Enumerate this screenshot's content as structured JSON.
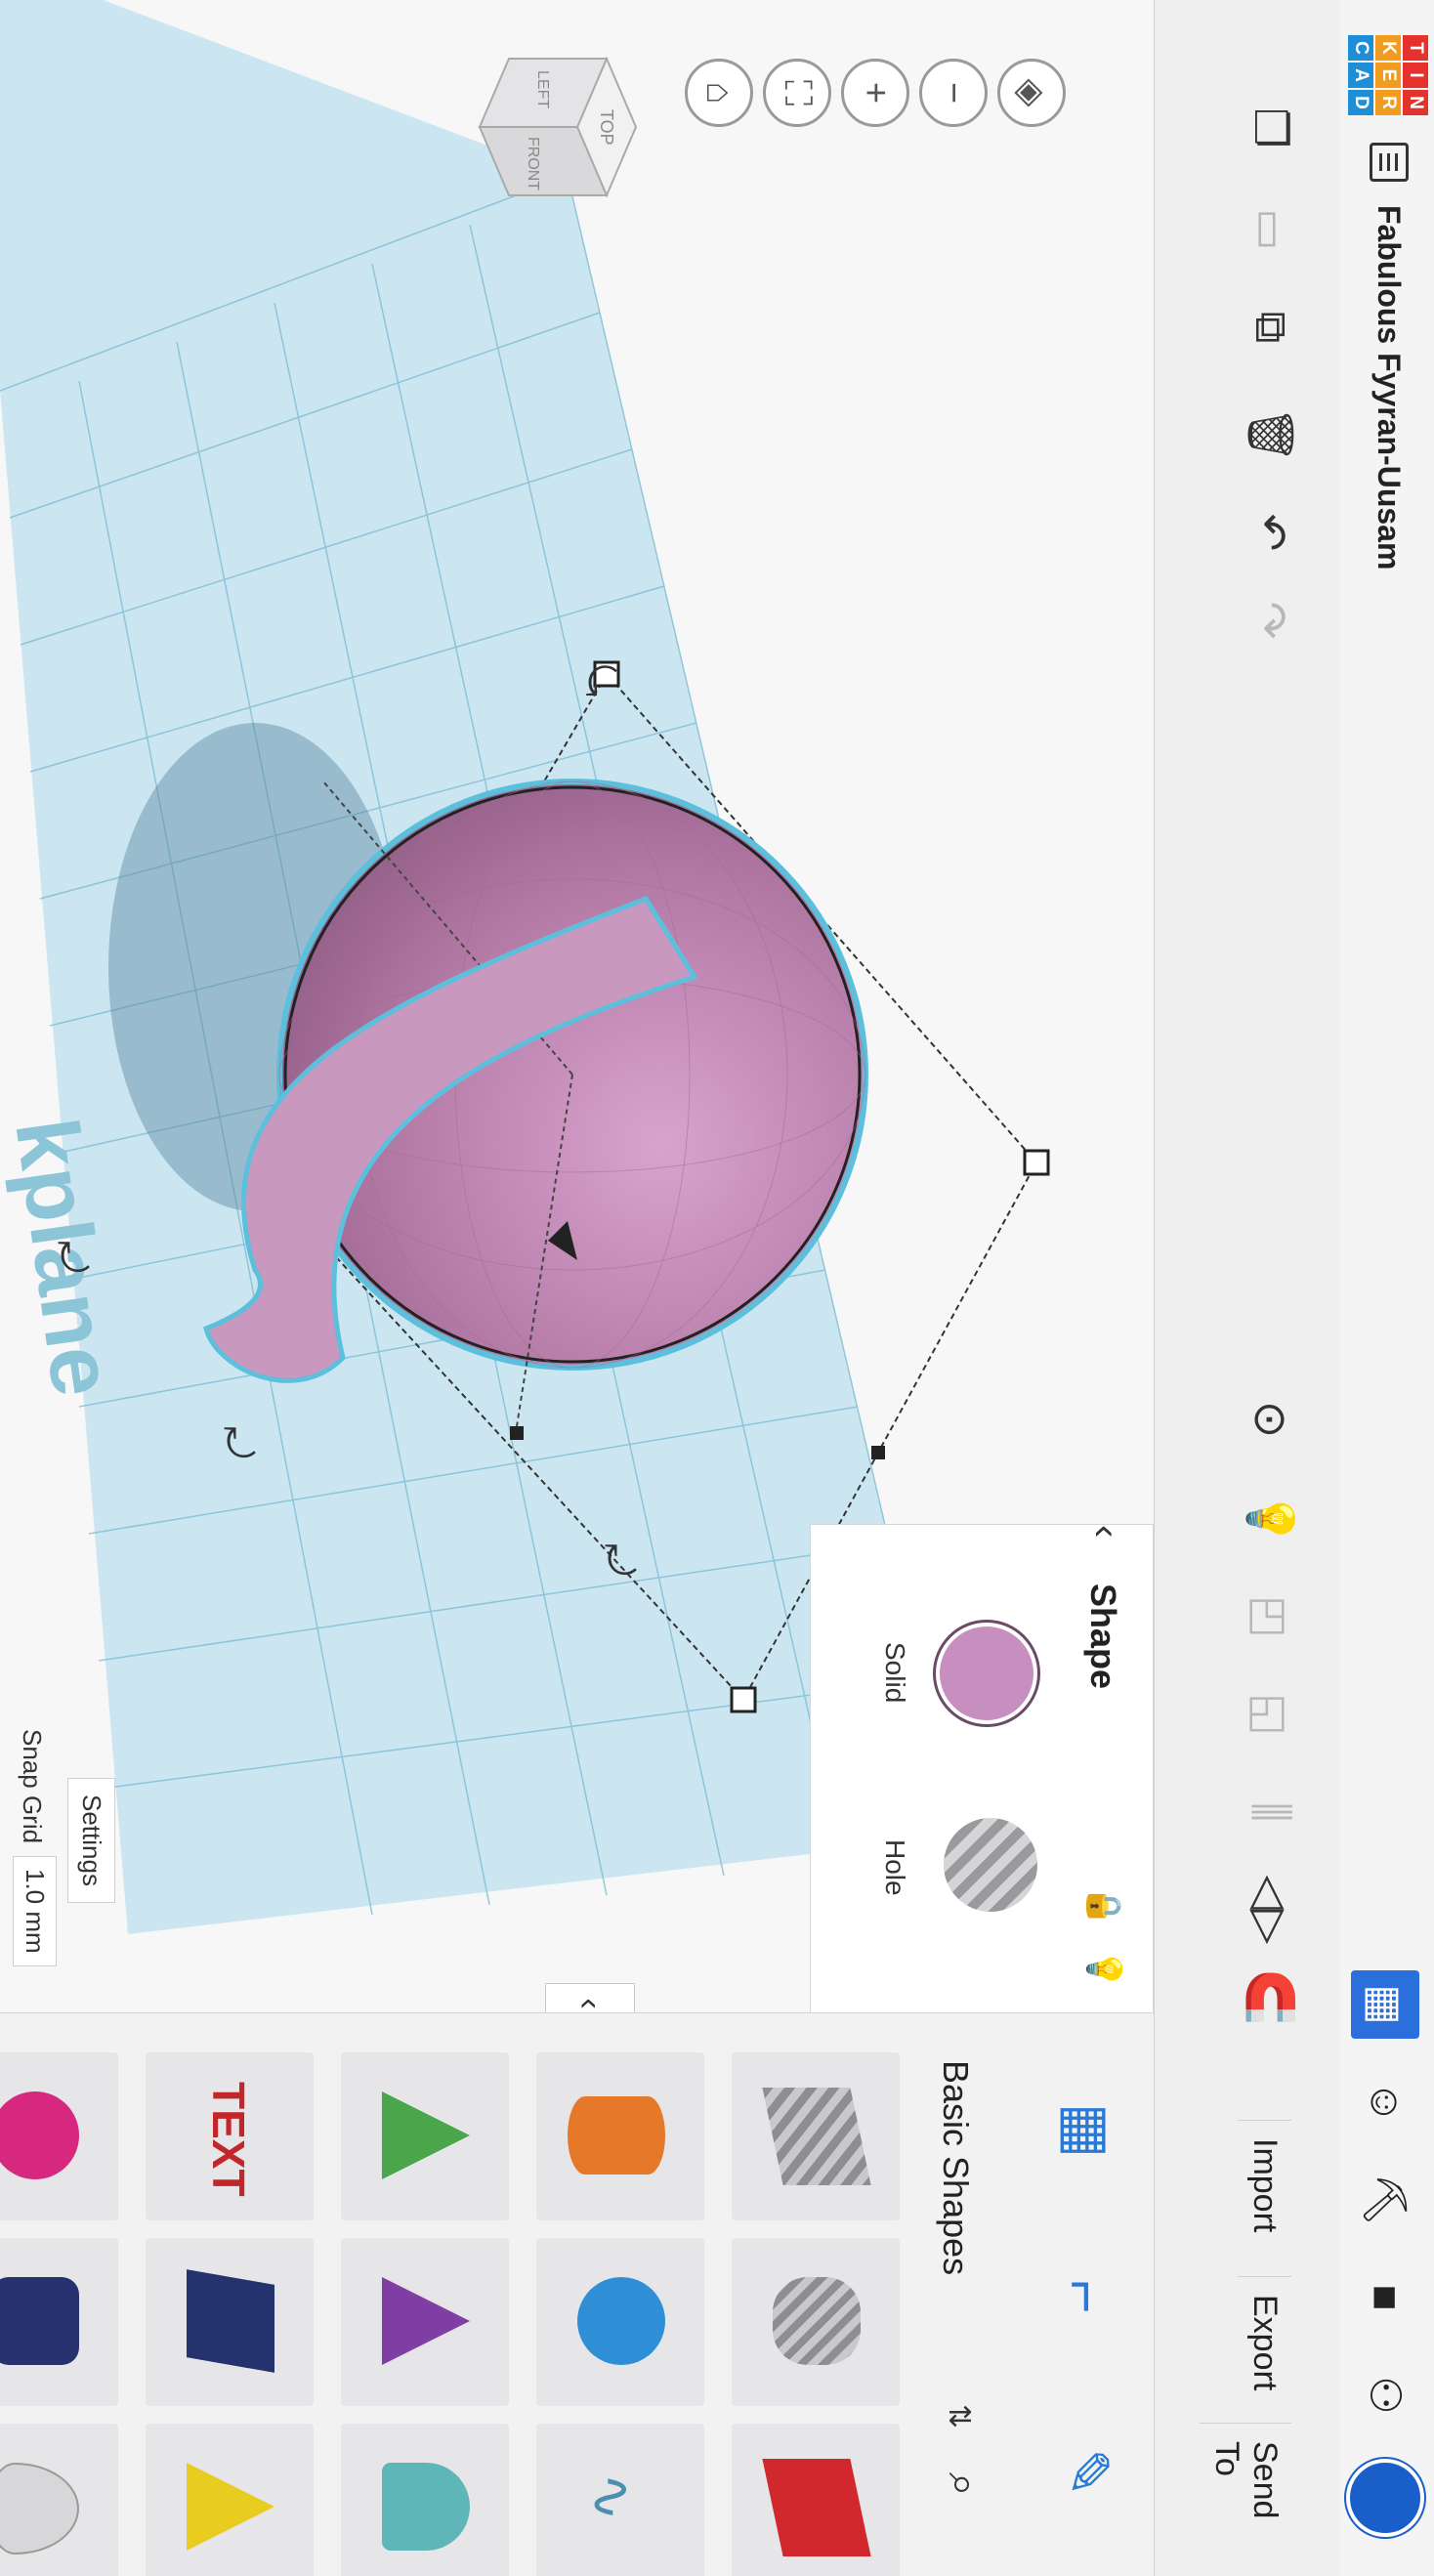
{
  "logo": {
    "letters": [
      "T",
      "I",
      "N",
      "K",
      "E",
      "R",
      "C",
      "A",
      "D"
    ],
    "colors": [
      "#e5322d",
      "#e5322d",
      "#e5322d",
      "#f29c1f",
      "#f29c1f",
      "#f29c1f",
      "#1e8fd6",
      "#1e8fd6",
      "#1e8fd6"
    ]
  },
  "design": {
    "title": "Fabulous Fyyran-Uusam"
  },
  "top_right": {
    "icons": [
      "grid-view-icon",
      "tinkerers-icon",
      "build-icon",
      "briefcase-icon",
      "add-user-icon",
      "avatar"
    ]
  },
  "toolbar": {
    "import_label": "Import",
    "export_label": "Export",
    "send_to_label": "Send To"
  },
  "view_cube": {
    "faces": [
      "TOP",
      "FRONT",
      "LEFT"
    ]
  },
  "workplane": {
    "label": "kplane"
  },
  "shape_panel": {
    "title": "Shape",
    "solid_label": "Solid",
    "hole_label": "Hole",
    "solid_color": "#c68fbf"
  },
  "right_panel": {
    "category": "Basic Shapes"
  },
  "bottom": {
    "settings_label": "Settings",
    "snap_grid_label": "Snap Grid",
    "snap_grid_value": "1.0 mm"
  }
}
